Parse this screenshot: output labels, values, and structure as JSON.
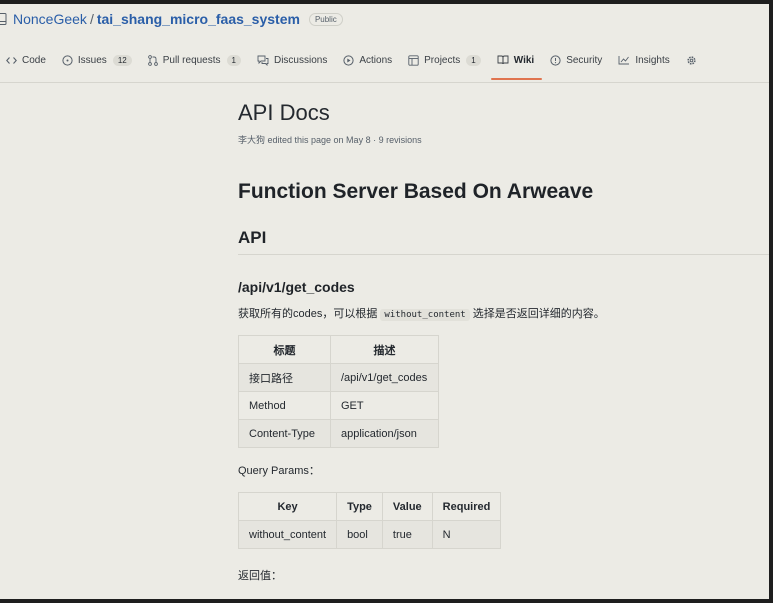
{
  "repo": {
    "owner": "NonceGeek",
    "separator": "/",
    "name": "tai_shang_micro_faas_system",
    "visibility": "Public"
  },
  "tabs": [
    {
      "label": "Code",
      "icon": "code-icon",
      "count": null,
      "active": false
    },
    {
      "label": "Issues",
      "icon": "issue-icon",
      "count": "12",
      "active": false
    },
    {
      "label": "Pull requests",
      "icon": "pull-request-icon",
      "count": "1",
      "active": false
    },
    {
      "label": "Discussions",
      "icon": "discussion-icon",
      "count": null,
      "active": false
    },
    {
      "label": "Actions",
      "icon": "play-icon",
      "count": null,
      "active": false
    },
    {
      "label": "Projects",
      "icon": "project-icon",
      "count": "1",
      "active": false
    },
    {
      "label": "Wiki",
      "icon": "book-icon",
      "count": null,
      "active": true
    },
    {
      "label": "Security",
      "icon": "shield-icon",
      "count": null,
      "active": false
    },
    {
      "label": "Insights",
      "icon": "graph-icon",
      "count": null,
      "active": false
    },
    {
      "label": "",
      "icon": "gear-icon",
      "count": null,
      "active": false
    }
  ],
  "page": {
    "title": "API Docs",
    "edited_info": "李大狗 edited this page on May 8 · 9 revisions"
  },
  "doc": {
    "h1": "Function Server Based On Arweave",
    "h2": "API",
    "endpoint": "/api/v1/get_codes",
    "desc_before": "获取所有的codes，可以根据 ",
    "desc_code": "without_content",
    "desc_after": " 选择是否返回详细的内容。",
    "table1": {
      "headers": [
        "标题",
        "描述"
      ],
      "rows": [
        [
          "接口路径",
          "/api/v1/get_codes"
        ],
        [
          "Method",
          "GET"
        ],
        [
          "Content-Type",
          "application/json"
        ]
      ]
    },
    "query_params_label": "Query Params：",
    "table2": {
      "headers": [
        "Key",
        "Type",
        "Value",
        "Required"
      ],
      "rows": [
        [
          "without_content",
          "bool",
          "true",
          "N"
        ]
      ]
    },
    "return_label": "返回值："
  },
  "colors": {
    "accent": "#e0744f",
    "link": "#2a5ea8",
    "background": "#ecebe5"
  }
}
